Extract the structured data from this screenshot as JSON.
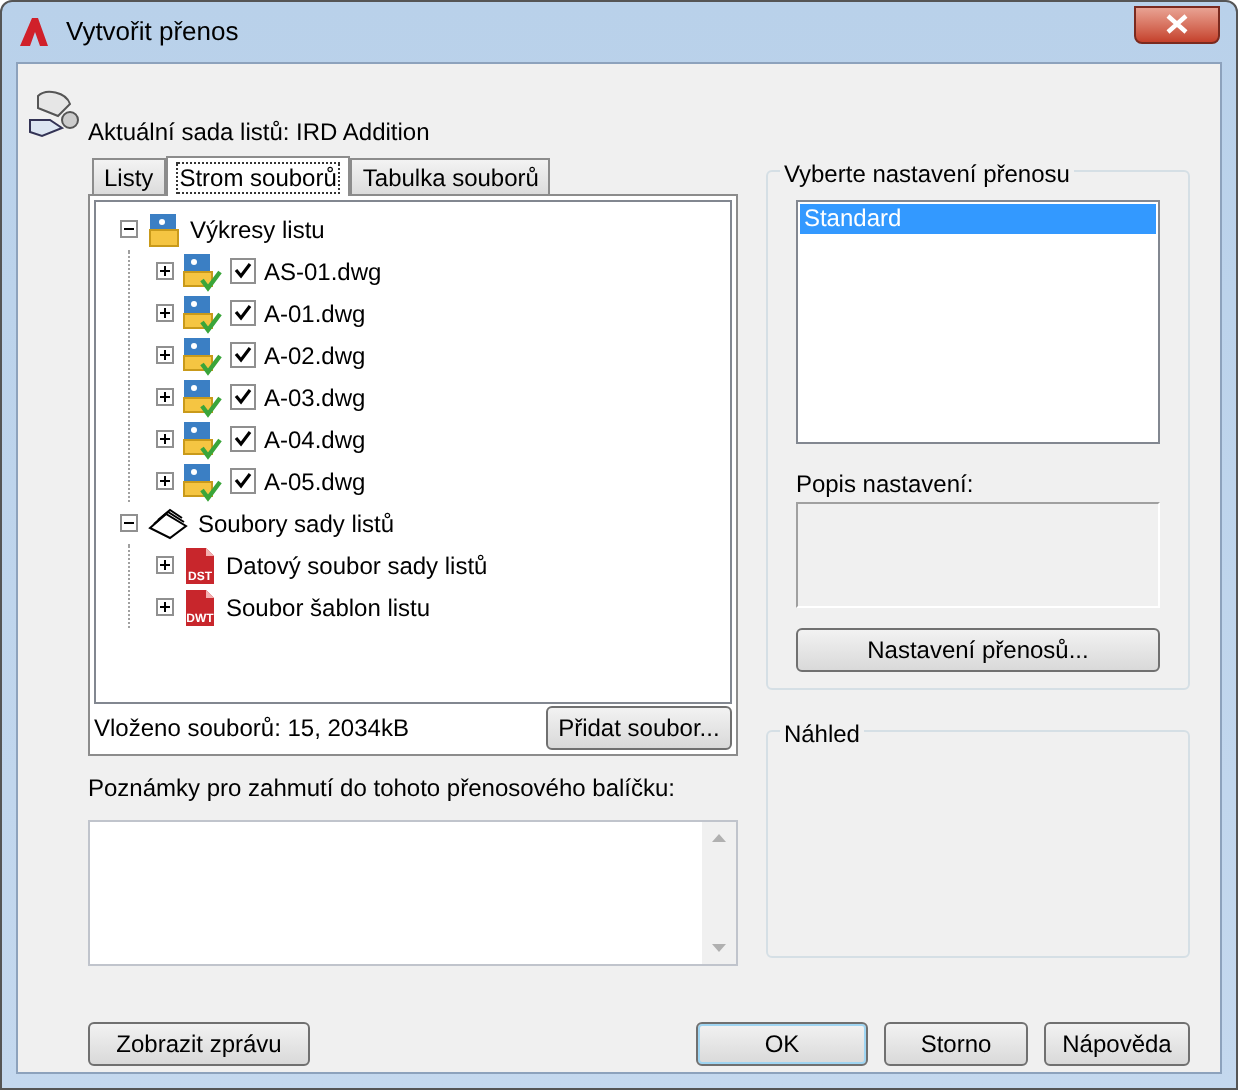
{
  "window": {
    "title": "Vytvořit přenos"
  },
  "sheet_set": {
    "label": "Aktuální sada listů: IRD Addition"
  },
  "tabs": [
    {
      "label": "Listy",
      "selected": false
    },
    {
      "label": "Strom souborů",
      "selected": true
    },
    {
      "label": "Tabulka souborů",
      "selected": false
    }
  ],
  "tree": [
    {
      "label": "Výkresy listu",
      "kind": "drawings",
      "expanded": true,
      "children": [
        {
          "label": "AS-01.dwg",
          "kind": "dwg",
          "checked": true,
          "expanded": false
        },
        {
          "label": "A-01.dwg",
          "kind": "dwg",
          "checked": true,
          "expanded": false
        },
        {
          "label": "A-02.dwg",
          "kind": "dwg",
          "checked": true,
          "expanded": false
        },
        {
          "label": "A-03.dwg",
          "kind": "dwg",
          "checked": true,
          "expanded": false
        },
        {
          "label": "A-04.dwg",
          "kind": "dwg",
          "checked": true,
          "expanded": false
        },
        {
          "label": "A-05.dwg",
          "kind": "dwg",
          "checked": true,
          "expanded": false
        }
      ]
    },
    {
      "label": "Soubory sady listů",
      "kind": "sheetset",
      "expanded": true,
      "children": [
        {
          "label": "Datový soubor sady listů",
          "kind": "file",
          "badge": "DST",
          "expanded": false
        },
        {
          "label": "Soubor šablon listu",
          "kind": "file",
          "badge": "DWT",
          "expanded": false
        }
      ]
    }
  ],
  "file_count": "Vloženo souborů: 15, 2034kB",
  "add_file_button": "Přidat soubor...",
  "notes": {
    "label": "Poznámky pro zahmutí do tohoto přenosového balíčku:"
  },
  "setups": {
    "title": "Vyberte nastavení přenosu",
    "items": [
      {
        "label": "Standard",
        "selected": true
      }
    ],
    "description_label": "Popis nastavení:",
    "button": "Nastavení přenosů..."
  },
  "preview": {
    "title": "Náhled"
  },
  "report_button": "Zobrazit zprávu",
  "buttons": [
    {
      "label": "OK",
      "default": true
    },
    {
      "label": "Storno",
      "default": false
    },
    {
      "label": "Nápověda",
      "default": false
    }
  ]
}
